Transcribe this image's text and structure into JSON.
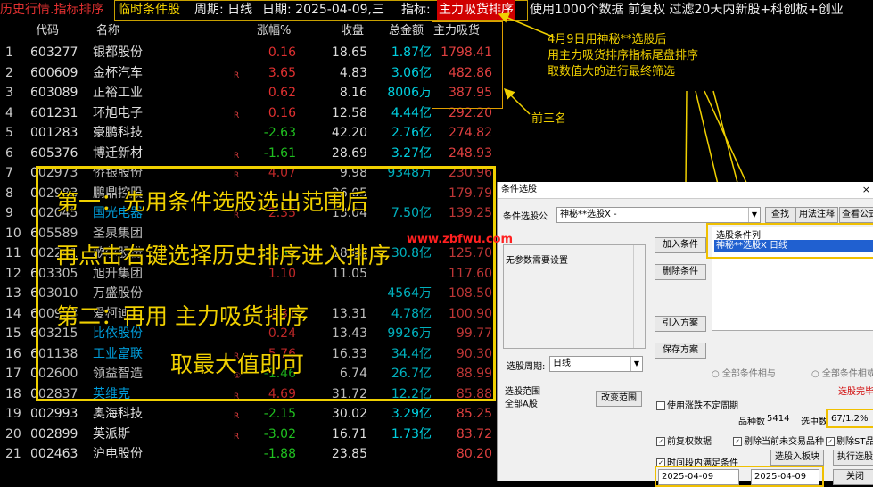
{
  "topbar": {
    "history_label": "历史行情.指标排序",
    "tool_label": "临时条件股",
    "period": "周期: 日线",
    "date": "日期: 2025-04-09,三",
    "indicator_prefix": "指标:",
    "indicator_value": "主力吸货排序",
    "info": "使用1000个数据 前复权 过滤20天内新股+科创板+创业"
  },
  "table": {
    "headers": {
      "code": "代码",
      "name": "名称",
      "change": "涨幅%",
      "price": "收盘",
      "amount": "总金额",
      "main": "主力吸货"
    },
    "rows": [
      {
        "idx": "1",
        "code": "603277",
        "name": "银都股份",
        "cyan": false,
        "flag": "",
        "chg": "0.16",
        "dir": "up",
        "price": "18.65",
        "amt": "1.87亿",
        "main": "1798.41"
      },
      {
        "idx": "2",
        "code": "600609",
        "name": "金杯汽车",
        "cyan": false,
        "flag": "R",
        "chg": "3.65",
        "dir": "up",
        "price": "4.83",
        "amt": "3.06亿",
        "main": "482.86"
      },
      {
        "idx": "3",
        "code": "603089",
        "name": "正裕工业",
        "cyan": false,
        "flag": "",
        "chg": "0.62",
        "dir": "up",
        "price": "8.16",
        "amt": "8006万",
        "main": "387.95"
      },
      {
        "idx": "4",
        "code": "601231",
        "name": "环旭电子",
        "cyan": false,
        "flag": "R",
        "chg": "0.16",
        "dir": "up",
        "price": "12.58",
        "amt": "4.44亿",
        "main": "292.20"
      },
      {
        "idx": "5",
        "code": "001283",
        "name": "豪鹏科技",
        "cyan": false,
        "flag": "",
        "chg": "-2.63",
        "dir": "down",
        "price": "42.20",
        "amt": "2.76亿",
        "main": "274.82"
      },
      {
        "idx": "6",
        "code": "605376",
        "name": "博迁新材",
        "cyan": false,
        "flag": "R",
        "chg": "-1.61",
        "dir": "down",
        "price": "28.69",
        "amt": "3.27亿",
        "main": "248.93"
      },
      {
        "idx": "7",
        "code": "002973",
        "name": "侨银股份",
        "cyan": false,
        "flag": "R",
        "chg": "4.07",
        "dir": "up",
        "price": "9.98",
        "amt": "9348万",
        "main": "230.96"
      },
      {
        "idx": "8",
        "code": "002983",
        "name": "鹏鼎控股",
        "cyan": false,
        "flag": "",
        "chg": "",
        "dir": "up",
        "price": "26.05",
        "amt": "",
        "main": "179.79"
      },
      {
        "idx": "9",
        "code": "002045",
        "name": "国光电器",
        "cyan": true,
        "flag": "R",
        "chg": "2.35",
        "dir": "up",
        "price": "13.04",
        "amt": "7.50亿",
        "main": "139.25"
      },
      {
        "idx": "10",
        "code": "605589",
        "name": "圣泉集团",
        "cyan": false,
        "flag": "",
        "chg": "",
        "dir": "up",
        "price": "",
        "amt": "",
        "main": ""
      },
      {
        "idx": "11",
        "code": "002241",
        "name": "歌尔股份",
        "cyan": false,
        "flag": "",
        "chg": "-0.37",
        "dir": "down",
        "price": "18.88",
        "amt": "30.8亿",
        "main": "125.70"
      },
      {
        "idx": "12",
        "code": "603305",
        "name": "旭升集团",
        "cyan": false,
        "flag": "",
        "chg": "1.10",
        "dir": "up",
        "price": "11.05",
        "amt": "",
        "main": "117.60"
      },
      {
        "idx": "13",
        "code": "603010",
        "name": "万盛股份",
        "cyan": false,
        "flag": "",
        "chg": "",
        "dir": "up",
        "price": "",
        "amt": "4564万",
        "main": "108.50"
      },
      {
        "idx": "14",
        "code": "600933",
        "name": "爱柯迪",
        "cyan": false,
        "flag": "",
        "chg": "2.31",
        "dir": "up",
        "price": "13.31",
        "amt": "4.78亿",
        "main": "100.90"
      },
      {
        "idx": "15",
        "code": "603215",
        "name": "比依股份",
        "cyan": true,
        "flag": "",
        "chg": "0.24",
        "dir": "up",
        "price": "13.43",
        "amt": "9926万",
        "main": "99.77"
      },
      {
        "idx": "16",
        "code": "601138",
        "name": "工业富联",
        "cyan": true,
        "flag": "R",
        "chg": "5.76",
        "dir": "up",
        "price": "16.33",
        "amt": "34.4亿",
        "main": "90.30"
      },
      {
        "idx": "17",
        "code": "002600",
        "name": "领益智造",
        "cyan": false,
        "flag": "①",
        "chg": "-1.46",
        "dir": "down",
        "price": "6.74",
        "amt": "26.7亿",
        "main": "88.99"
      },
      {
        "idx": "18",
        "code": "002837",
        "name": "英维克",
        "cyan": true,
        "flag": "R",
        "chg": "4.69",
        "dir": "up",
        "price": "31.72",
        "amt": "12.2亿",
        "main": "85.88"
      },
      {
        "idx": "19",
        "code": "002993",
        "name": "奥海科技",
        "cyan": false,
        "flag": "R",
        "chg": "-2.15",
        "dir": "down",
        "price": "30.02",
        "amt": "3.29亿",
        "main": "85.25"
      },
      {
        "idx": "20",
        "code": "002899",
        "name": "英派斯",
        "cyan": false,
        "flag": "R",
        "chg": "-3.02",
        "dir": "down",
        "price": "16.71",
        "amt": "1.73亿",
        "main": "83.72"
      },
      {
        "idx": "21",
        "code": "002463",
        "name": "沪电股份",
        "cyan": false,
        "flag": "",
        "chg": "-1.88",
        "dir": "down",
        "price": "23.85",
        "amt": "",
        "main": "80.20"
      }
    ]
  },
  "annotations": {
    "note_lines": [
      "4月9日用神秘**选股后",
      "用主力吸货排序指标尾盘排序",
      "取数值大的进行最终筛选"
    ],
    "top3": "前三名",
    "overlay_line1": "第一：先用条件选股选出范围后",
    "overlay_line2": "再点击右键选择历史排序进入排序",
    "overlay_line3": "第二：再用 主力吸货排序",
    "overlay_line4": "取最大值即可",
    "watermark": "www.zbfwu.com"
  },
  "dialog": {
    "title": "条件选股",
    "close": "×",
    "formula_label": "条件选股公",
    "formula_value": "神秘**选股X  -",
    "btn_search": "查找",
    "btn_usage": "用法注释",
    "btn_view": "查看公式",
    "param_text": "无参数需要设置",
    "btn_add": "加入条件",
    "btn_delete": "删除条件",
    "btn_import": "引入方案",
    "btn_save": "保存方案",
    "cond_list_header": "选股条件列",
    "cond_item": "神秘**选股X  日线",
    "period_label": "选股周期:",
    "period_value": "日线",
    "radio_and": "全部条件相与",
    "radio_or": "全部条件相或",
    "pick_done": "选股完毕",
    "range_label": "选股范围",
    "range_value": "全部A股",
    "btn_change_range": "改变范围",
    "chk_noadj": "使用涨跌不定周期",
    "stock_count_label": "品种数",
    "stock_count": "5414",
    "selected_label": "选中数",
    "selected_value": "67/1.2%",
    "chk_prev": "前复权数据",
    "chk_remove_suspended": "剔除当前未交易品种",
    "chk_remove_st": "剔除ST品种",
    "chk_time": "时间段内满足条件",
    "btn_to_board": "选股入板块",
    "btn_execute": "执行选股",
    "date_from": "2025-04-09",
    "date_to": "2025-04-09",
    "btn_close": "关闭"
  }
}
